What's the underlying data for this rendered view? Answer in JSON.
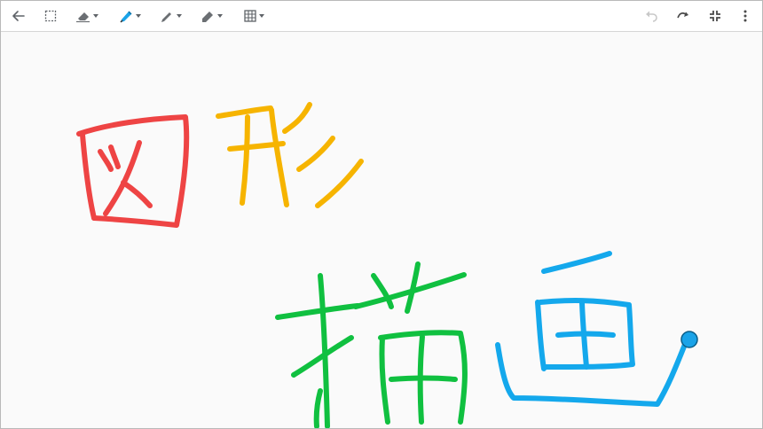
{
  "toolbar": {
    "left_tools": [
      {
        "id": "back",
        "icon": "arrow-left-icon"
      },
      {
        "id": "select",
        "icon": "select-box-icon"
      },
      {
        "id": "eraser",
        "icon": "eraser-icon",
        "has_menu": true
      },
      {
        "id": "highlighter",
        "icon": "highlighter-icon",
        "has_menu": true,
        "active": true,
        "color": "#1aa3e8"
      },
      {
        "id": "pen",
        "icon": "pen-icon",
        "has_menu": true
      },
      {
        "id": "marker",
        "icon": "marker-icon",
        "has_menu": true
      },
      {
        "id": "grid",
        "icon": "grid-icon",
        "has_menu": true
      }
    ],
    "right_tools": [
      {
        "id": "undo",
        "icon": "undo-icon",
        "disabled": true
      },
      {
        "id": "redo",
        "icon": "redo-icon"
      },
      {
        "id": "exit-fullscreen",
        "icon": "exit-fullscreen-icon"
      },
      {
        "id": "more",
        "icon": "more-vert-icon"
      }
    ]
  },
  "canvas": {
    "background": "#fafafa",
    "stroke_colors": {
      "red": "#ee4444",
      "orange": "#f6b400",
      "green": "#10c040",
      "blue": "#14a8ec"
    },
    "cursor_color": "#1aa3e8"
  }
}
